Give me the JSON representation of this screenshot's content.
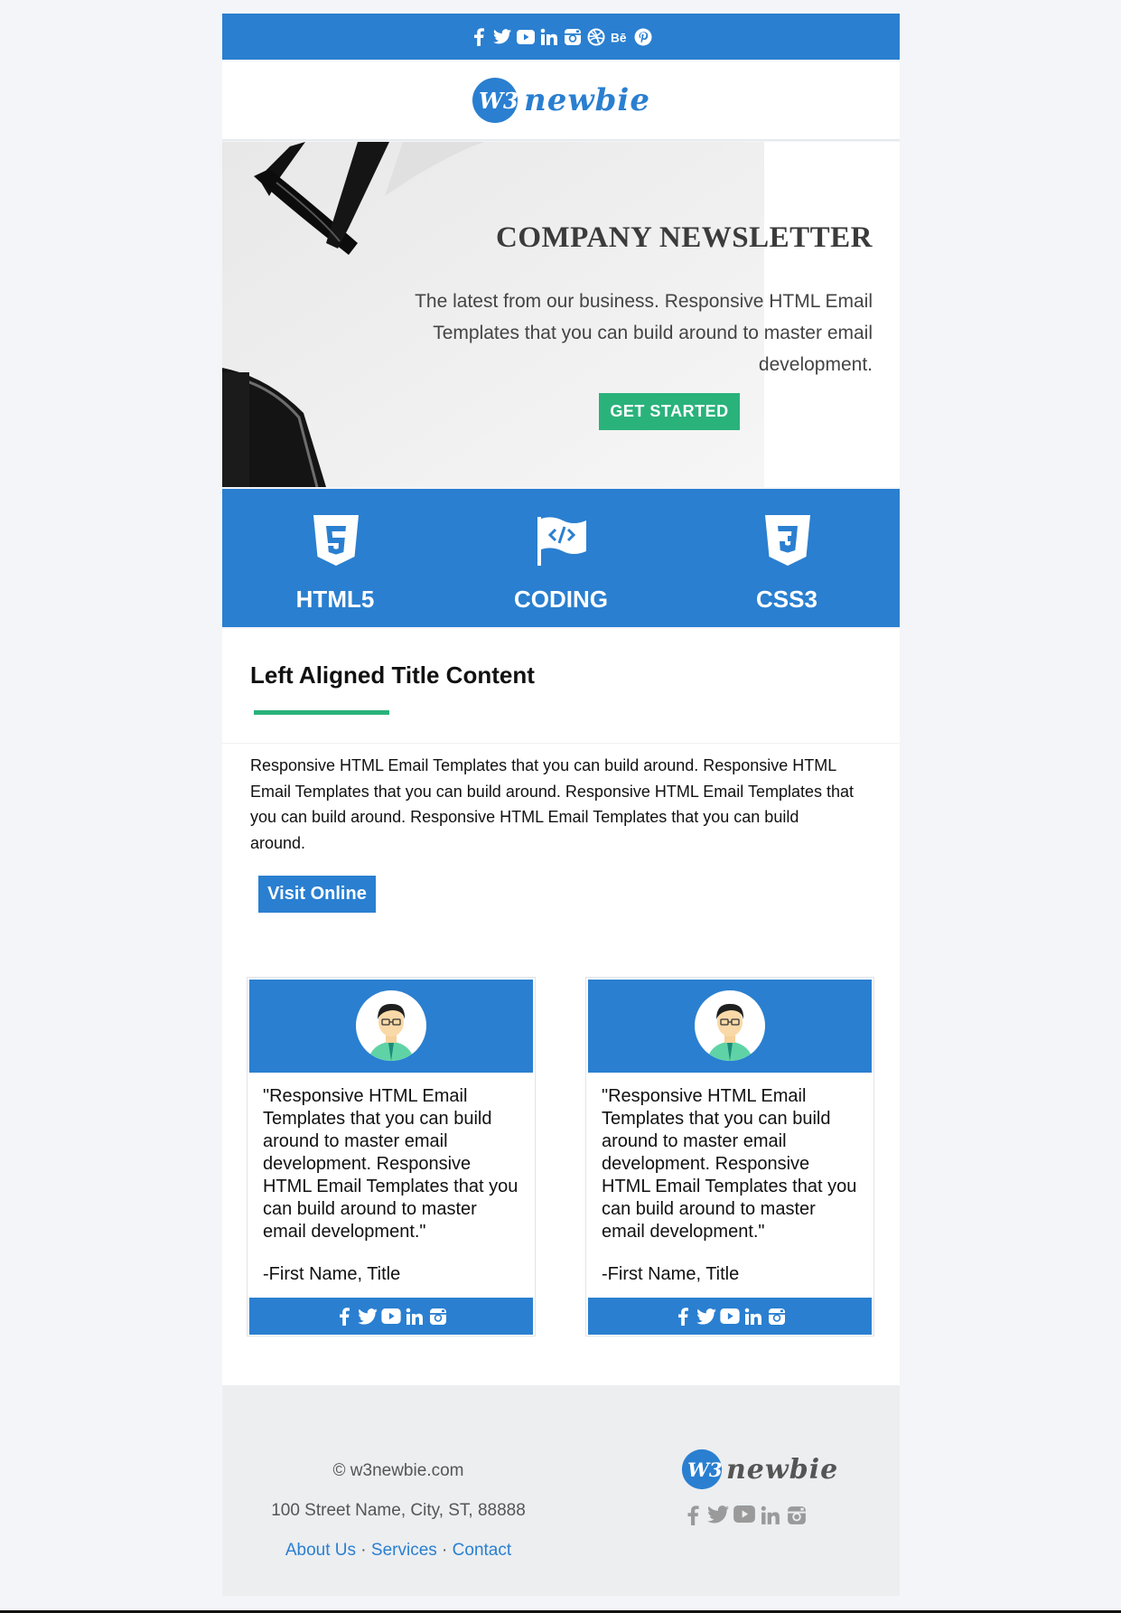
{
  "brand": {
    "logo_mark": "W3",
    "logo_text": "newbie",
    "accent": "#2a7fd0",
    "green": "#2ab27b"
  },
  "topbar": {
    "icons": [
      "facebook-icon",
      "twitter-icon",
      "youtube-icon",
      "linkedin-icon",
      "instagram-icon",
      "dribbble-icon",
      "behance-icon",
      "pinterest-icon"
    ]
  },
  "hero": {
    "title": "COMPANY NEWSLETTER",
    "text": "The latest from our business. Responsive HTML Email Templates that you can build around to master email development.",
    "cta": "GET STARTED"
  },
  "features": [
    {
      "label": "HTML5",
      "icon": "html5-icon"
    },
    {
      "label": "CODING",
      "icon": "code-flag-icon"
    },
    {
      "label": "CSS3",
      "icon": "css3-icon"
    }
  ],
  "section": {
    "title": "Left Aligned Title Content",
    "body": "Responsive HTML Email Templates that you can build around. Responsive HTML Email Templates that you can build around. Responsive HTML Email Templates that you can build around. Responsive HTML Email Templates that you can build around.",
    "button": "Visit Online"
  },
  "testimonials": [
    {
      "quote": "\"Responsive HTML Email Templates that you can build around to master email development. Responsive HTML Email Templates that you can build around to master email development.\"",
      "signature": "-First Name, Title"
    },
    {
      "quote": "\"Responsive HTML Email Templates that you can build around to master email development. Responsive HTML Email Templates that you can build around to master email development.\"",
      "signature": "-First Name, Title"
    }
  ],
  "footer": {
    "copyright": "© w3newbie.com",
    "address": "100 Street Name, City, ST, 88888",
    "links": {
      "about": "About Us",
      "services": "Services",
      "contact": "Contact",
      "sep": "·"
    }
  }
}
